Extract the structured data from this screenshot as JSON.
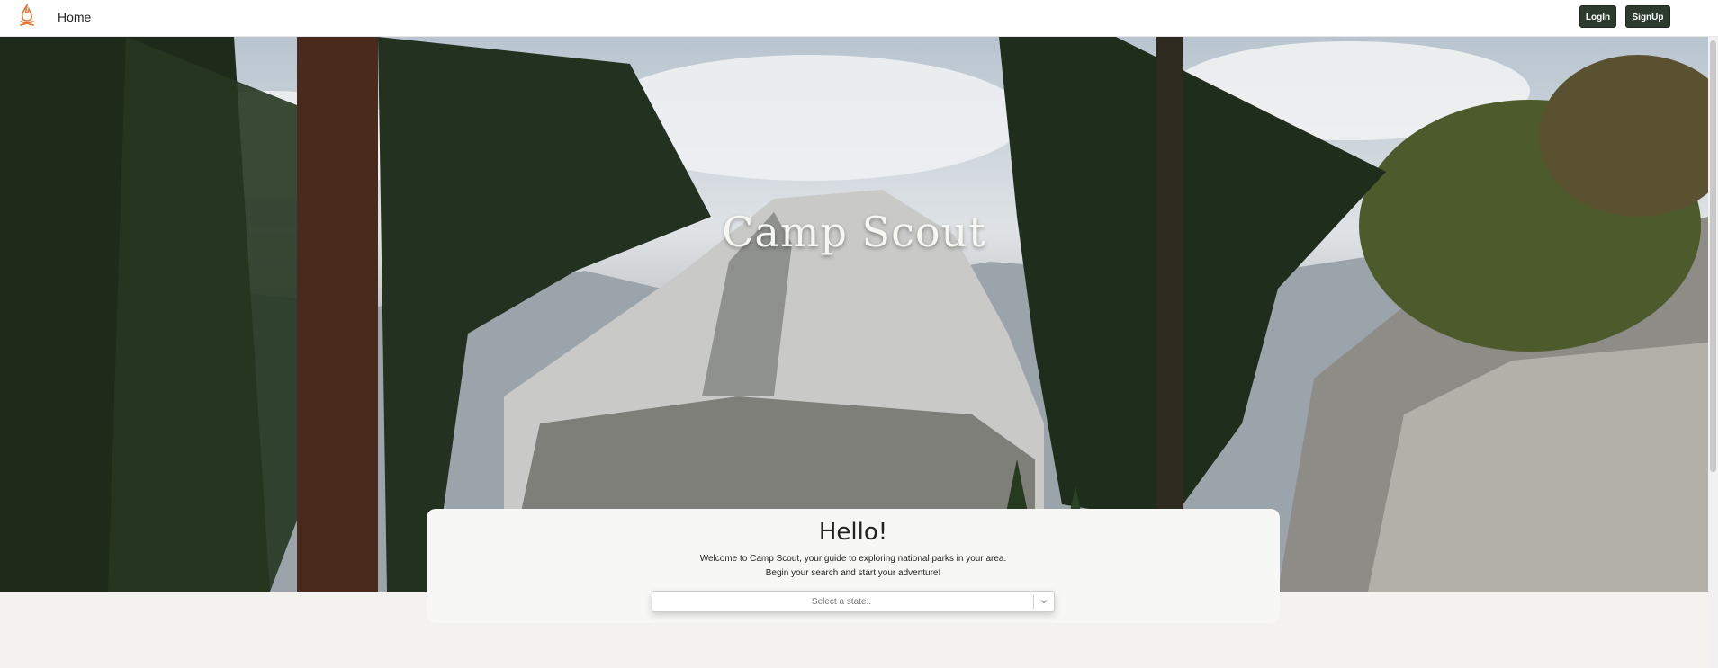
{
  "nav": {
    "home_label": "Home",
    "login_label": "LogIn",
    "signup_label": "SignUp",
    "logo_icon": "campfire-icon"
  },
  "hero": {
    "title": "Camp Scout",
    "image": "mountain-forest-landscape"
  },
  "welcome_card": {
    "heading": "Hello!",
    "line1": "Welcome to Camp Scout, your guide to exploring national parks in your area.",
    "line2": "Begin your search and start your adventure!",
    "state_select": {
      "placeholder": "Select a state..",
      "icon": "chevron-down-icon"
    }
  },
  "colors": {
    "accent": "#e07a3f",
    "button_bg": "#2d3b2f",
    "page_bg": "#f3f2ef",
    "card_bg": "#f7f7f6"
  }
}
